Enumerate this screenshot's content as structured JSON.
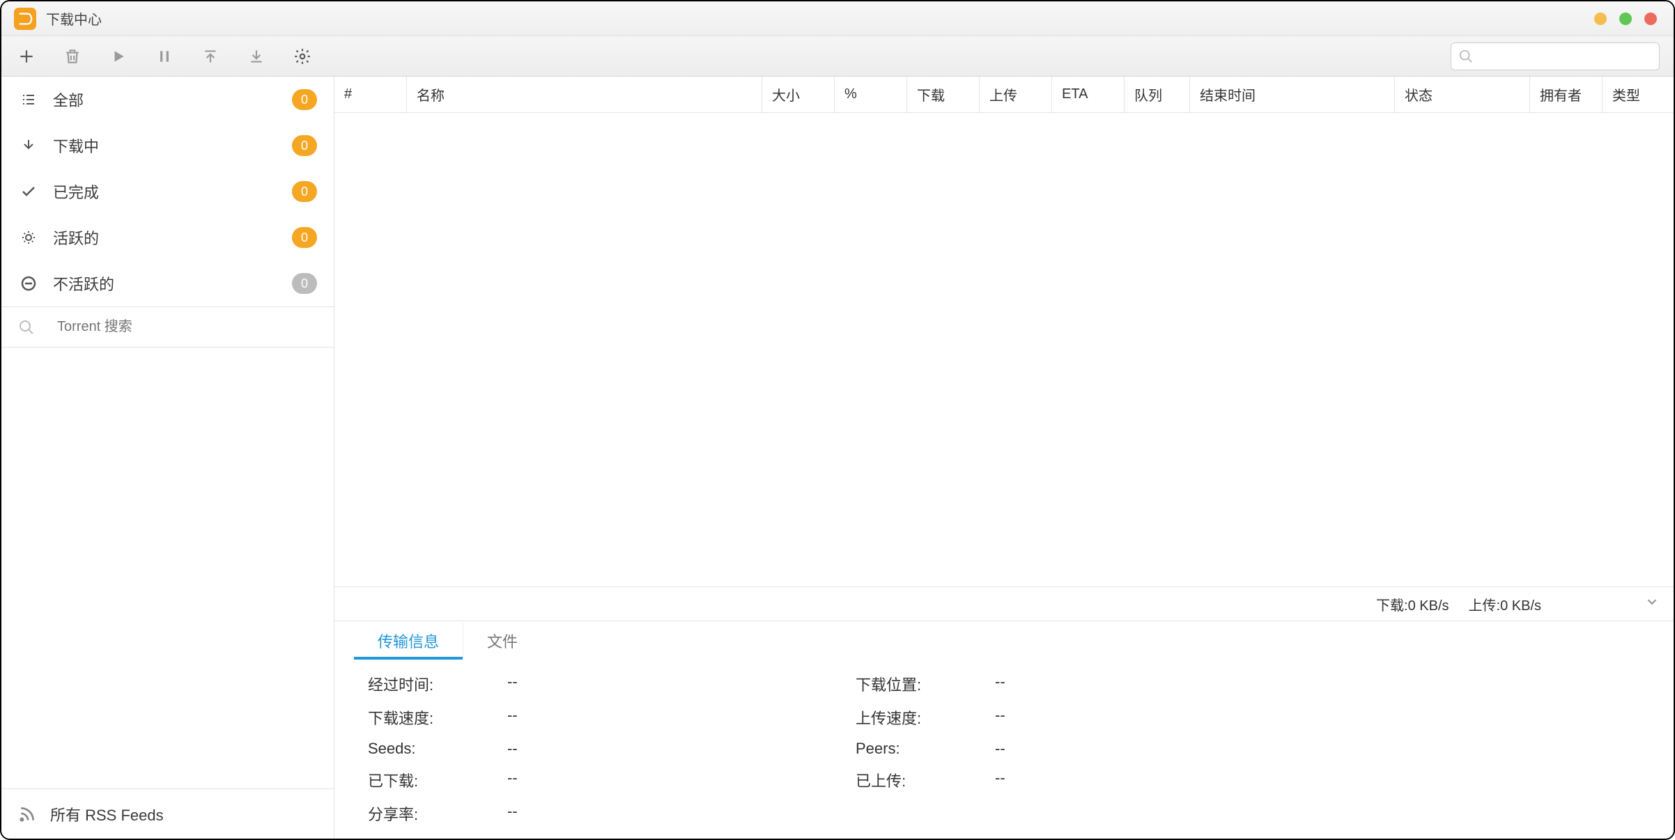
{
  "window": {
    "title": "下载中心"
  },
  "traffic": {
    "minimize": "#f5bd4f",
    "maximize": "#61c654",
    "close": "#ed6a5e"
  },
  "toolbar": {
    "search_placeholder": ""
  },
  "sidebar": {
    "items": [
      {
        "label": "全部",
        "count": "0",
        "grey": false
      },
      {
        "label": "下载中",
        "count": "0",
        "grey": false
      },
      {
        "label": "已完成",
        "count": "0",
        "grey": false
      },
      {
        "label": "活跃的",
        "count": "0",
        "grey": false
      },
      {
        "label": "不活跃的",
        "count": "0",
        "grey": true
      }
    ],
    "torrent_search_placeholder": "Torrent 搜索",
    "rss_label": "所有 RSS Feeds"
  },
  "columns": {
    "num": "#",
    "name": "名称",
    "size": "大小",
    "percent": "%",
    "download": "下载",
    "upload": "上传",
    "eta": "ETA",
    "queue": "队列",
    "end_time": "结束时间",
    "status": "状态",
    "owner": "拥有者",
    "type": "类型"
  },
  "status": {
    "download_label": "下载:",
    "download_value": "0 KB/s",
    "upload_label": "上传:",
    "upload_value": "0 KB/s"
  },
  "tabs": {
    "transfer": "传输信息",
    "files": "文件"
  },
  "transfer_info": {
    "elapsed_label": "经过时间:",
    "elapsed_value": "--",
    "dest_label": "下载位置:",
    "dest_value": "--",
    "dlspeed_label": "下载速度:",
    "dlspeed_value": "--",
    "ulspeed_label": "上传速度:",
    "ulspeed_value": "--",
    "seeds_label": "Seeds:",
    "seeds_value": "--",
    "peers_label": "Peers:",
    "peers_value": "--",
    "downloaded_label": "已下载:",
    "downloaded_value": "--",
    "uploaded_label": "已上传:",
    "uploaded_value": "--",
    "ratio_label": "分享率:",
    "ratio_value": "--"
  }
}
